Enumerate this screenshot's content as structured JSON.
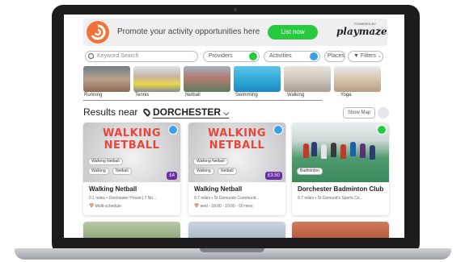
{
  "banner": {
    "text": "Promote your activity opportunities here",
    "cta_label": "List now",
    "powered_by": "POWERED BY",
    "brand": "playmaze"
  },
  "search": {
    "placeholder": "Keyword Search"
  },
  "filters": {
    "providers_label": "Providers",
    "activities_label": "Activities",
    "places_label": "Places",
    "filters_label": "Filters"
  },
  "categories": [
    {
      "label": "Running"
    },
    {
      "label": "Tennis"
    },
    {
      "label": "Netball"
    },
    {
      "label": "Swimming"
    },
    {
      "label": "Walking"
    },
    {
      "label": "Yoga"
    }
  ],
  "results": {
    "prefix": "Results near",
    "place": "DORCHESTER",
    "show_map": "Show Map"
  },
  "cards": [
    {
      "image_text_1": "WALKING",
      "image_text_2": "NETBALL",
      "tag_top": "Walking Netball",
      "tag_a": "Walking",
      "tag_b": "Netball",
      "price": "£4",
      "title": "Walking Netball",
      "meta": "0.1 miles  •  Dorchester Prison | 7 No...",
      "schedule": "Multi-schedule"
    },
    {
      "image_text_1": "WALKING",
      "image_text_2": "NETBALL",
      "tag_top": "Walking Netball",
      "tag_a": "Walking",
      "tag_b": "Netball",
      "price": "£3.50",
      "title": "Walking Netball",
      "meta": "0.7 miles  •  St Osmunds Communit...",
      "schedule": "wed - 18:00 - 19:00 - 60 mins"
    },
    {
      "tag_a": "Badminton",
      "title": "Dorchester Badminton Club",
      "meta": "0.7 miles  •  St Osmund's Sports Ce..."
    }
  ],
  "colors": {
    "accent_green": "#27c93f",
    "price_purple": "#6b2ea6",
    "logo_orange": "#f2733a",
    "provider_blue": "#3aa0e8"
  }
}
